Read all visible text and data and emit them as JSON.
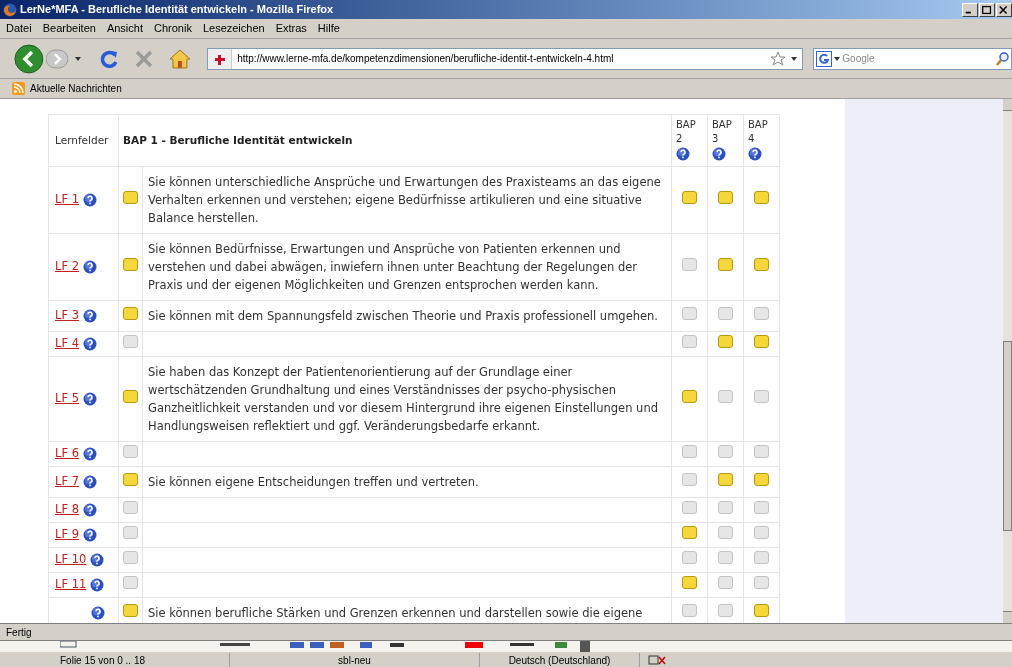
{
  "window": {
    "title": "LerNe*MFA - Berufliche Identität entwickeln - Mozilla Firefox"
  },
  "menu": [
    "Datei",
    "Bearbeiten",
    "Ansicht",
    "Chronik",
    "Lesezeichen",
    "Extras",
    "Hilfe"
  ],
  "navigation": {
    "url": "http://www.lerne-mfa.de/kompetenzdimensionen/berufliche-identit-t-entwickeln-4.html",
    "search_placeholder": "Google"
  },
  "bookmarks": [
    "Aktuelle Nachrichten"
  ],
  "table": {
    "columns": [
      "Lernfelder",
      "BAP 1 - Berufliche Identität entwickeln",
      "BAP 2",
      "BAP 3",
      "BAP 4"
    ],
    "rows": [
      {
        "lf": "LF 1",
        "checked": true,
        "text": "Sie können unterschiedliche Ansprüche und Erwartungen des Praxisteams an das eigene Verhalten erkennen und verstehen; eigene Bedürfnisse artikulieren und eine situative Balance herstellen.",
        "bap": [
          true,
          true,
          true
        ]
      },
      {
        "lf": "LF 2",
        "checked": true,
        "text": "Sie können Bedürfnisse, Erwartungen und Ansprüche von Patienten erkennen und verstehen und dabei abwägen, inwiefern ihnen unter Beachtung der Regelungen der Praxis und der eigenen Möglichkeiten und Grenzen entsprochen werden kann.",
        "bap": [
          false,
          true,
          true
        ]
      },
      {
        "lf": "LF 3",
        "checked": true,
        "text": "Sie können mit dem Spannungsfeld zwischen Theorie und Praxis professionell umgehen.",
        "bap": [
          false,
          false,
          false
        ]
      },
      {
        "lf": "LF 4",
        "checked": false,
        "bap": [
          false,
          true,
          true
        ]
      },
      {
        "lf": "LF 5",
        "checked": true,
        "text": "Sie haben das Konzept der Patientenorientierung auf der Grundlage einer wertschätzenden Grundhaltung und eines Verständnisses der psycho-physischen Ganzheitlichkeit verstanden und vor diesem Hintergrund ihre eigenen Einstellungen und Handlungsweisen reflektiert und ggf. Veränderungsbedarfe erkannt.",
        "bap": [
          true,
          false,
          false
        ]
      },
      {
        "lf": "LF 6",
        "checked": false,
        "bap": [
          false,
          false,
          false
        ]
      },
      {
        "lf": "LF 7",
        "checked": true,
        "text": "Sie können eigene Entscheidungen treffen und vertreten.",
        "bap": [
          false,
          true,
          true
        ]
      },
      {
        "lf": "LF 8",
        "checked": false,
        "bap": [
          false,
          false,
          false
        ]
      },
      {
        "lf": "LF 9",
        "checked": false,
        "bap": [
          true,
          false,
          false
        ]
      },
      {
        "lf": "LF 10",
        "checked": false,
        "bap": [
          false,
          false,
          false
        ]
      },
      {
        "lf": "LF 11",
        "checked": false,
        "bap": [
          true,
          false,
          false
        ]
      },
      {
        "checked": true,
        "text": "Sie können berufliche Stärken und Grenzen erkennen und darstellen sowie die eigene",
        "bap": [
          false,
          false,
          true
        ]
      }
    ]
  },
  "status_bar": "Fertig",
  "taskbar_status": [
    "Folie 15 von 0 .. 18",
    "sbl-neu",
    "Deutsch (Deutschland)"
  ]
}
